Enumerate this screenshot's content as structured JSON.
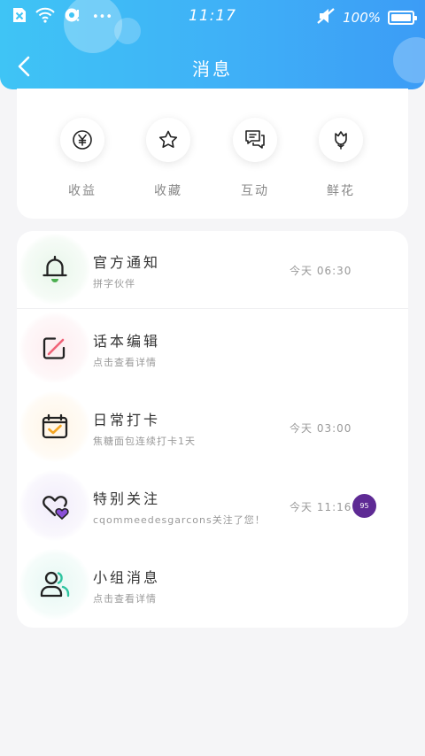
{
  "status_bar": {
    "time": "11:17",
    "battery": "100%",
    "more_dots": "•••"
  },
  "nav": {
    "title": "消息"
  },
  "quick_actions": [
    {
      "label": "收益",
      "icon": "yen-icon"
    },
    {
      "label": "收藏",
      "icon": "star-icon"
    },
    {
      "label": "互动",
      "icon": "chat-icon"
    },
    {
      "label": "鲜花",
      "icon": "flower-icon"
    }
  ],
  "messages": [
    {
      "title": "官方通知",
      "subtitle": "拼字伙伴",
      "time": "今天 06:30",
      "icon": "bell-icon"
    },
    {
      "title": "话本编辑",
      "subtitle": "点击查看详情",
      "time": "",
      "icon": "edit-icon"
    },
    {
      "title": "日常打卡",
      "subtitle": "焦糖面包连续打卡1天",
      "time": "今天 03:00",
      "icon": "calendar-check-icon"
    },
    {
      "title": "特别关注",
      "subtitle": "cqommeedesgarcons关注了您！",
      "time": "今天 11:16",
      "badge": "95",
      "icon": "hearts-icon"
    },
    {
      "title": "小组消息",
      "subtitle": "点击查看详情",
      "time": "",
      "icon": "group-icon"
    }
  ],
  "colors": {
    "header_start": "#3fc4f5",
    "header_end": "#3c9cf6",
    "badge": "#5e2a94",
    "bell_accent": "#4caf50",
    "edit_accent": "#f06277",
    "calendar_accent": "#f5a623",
    "heart_accent": "#8a4fd8",
    "group_accent": "#2ec4a0"
  }
}
